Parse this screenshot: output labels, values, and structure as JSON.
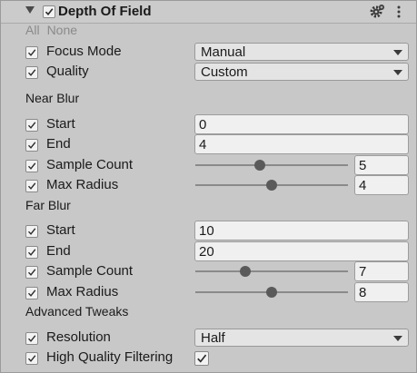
{
  "header": {
    "title": "Depth Of Field",
    "enabled": true,
    "settings_icon": "gear-icon",
    "menu_icon": "kebab-menu-icon"
  },
  "toggles": {
    "all": "All",
    "none": "None"
  },
  "focus_mode": {
    "label": "Focus Mode",
    "value": "Manual"
  },
  "quality": {
    "label": "Quality",
    "value": "Custom"
  },
  "near_blur": {
    "heading": "Near Blur",
    "start": {
      "label": "Start",
      "value": "0"
    },
    "end": {
      "label": "End",
      "value": "4"
    },
    "sample_count": {
      "label": "Sample Count",
      "value": "5",
      "fraction": 0.42
    },
    "max_radius": {
      "label": "Max Radius",
      "value": "4",
      "fraction": 0.5
    }
  },
  "far_blur": {
    "heading": "Far Blur",
    "start": {
      "label": "Start",
      "value": "10"
    },
    "end": {
      "label": "End",
      "value": "20"
    },
    "sample_count": {
      "label": "Sample Count",
      "value": "7",
      "fraction": 0.33
    },
    "max_radius": {
      "label": "Max Radius",
      "value": "8",
      "fraction": 0.5
    }
  },
  "advanced": {
    "heading": "Advanced Tweaks",
    "resolution": {
      "label": "Resolution",
      "value": "Half"
    },
    "high_quality_filtering": {
      "label": "High Quality Filtering",
      "checked": true
    }
  }
}
